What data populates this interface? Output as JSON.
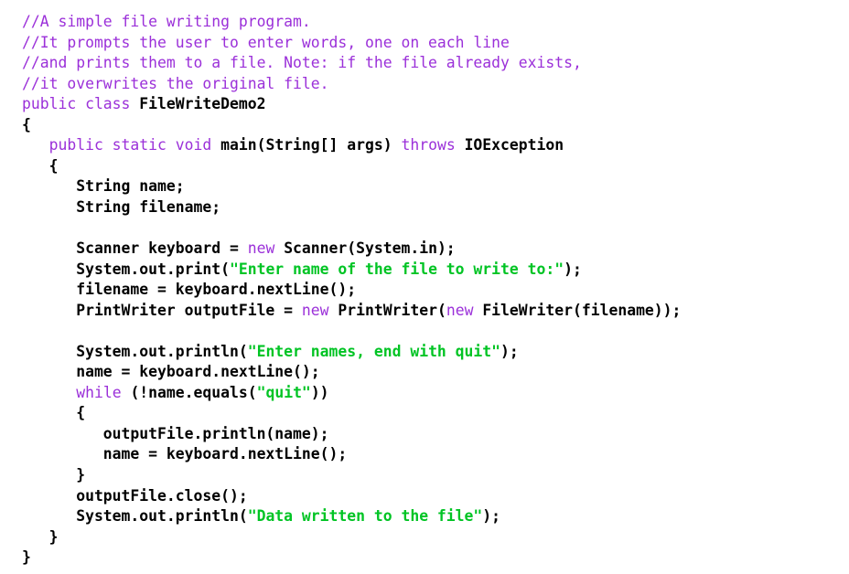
{
  "document": {
    "kind": "source-code-listing",
    "language": "Java",
    "class_name": "FileWriteDemo2",
    "background_color": "#ffffff",
    "colors": {
      "comment": "#9B30D9",
      "keyword": "#9B30D9",
      "string": "#00C424",
      "plain": "#000000"
    }
  },
  "code": {
    "lines": [
      {
        "n": 1,
        "text": "//A simple file writing program.",
        "tokens": [
          {
            "t": "comment",
            "v": "//A simple file writing program."
          }
        ]
      },
      {
        "n": 2,
        "text": "//It prompts the user to enter words, one on each line",
        "tokens": [
          {
            "t": "comment",
            "v": "//It prompts the user to enter words, one on each line"
          }
        ]
      },
      {
        "n": 3,
        "text": "//and prints them to a file. Note: if the file already exists,",
        "tokens": [
          {
            "t": "comment",
            "v": "//and prints them to a file. Note: if the file already exists,"
          }
        ]
      },
      {
        "n": 4,
        "text": "//it overwrites the original file.",
        "tokens": [
          {
            "t": "comment",
            "v": "//it overwrites the original file."
          }
        ]
      },
      {
        "n": 5,
        "text": "public class FileWriteDemo2",
        "tokens": [
          {
            "t": "keyword",
            "v": "public class "
          },
          {
            "t": "plain",
            "v": "FileWriteDemo2"
          }
        ]
      },
      {
        "n": 6,
        "text": "{",
        "tokens": [
          {
            "t": "plain",
            "v": "{"
          }
        ]
      },
      {
        "n": 7,
        "text": "   public static void main(String[] args) throws IOException",
        "tokens": [
          {
            "t": "plain",
            "v": "   "
          },
          {
            "t": "keyword",
            "v": "public static void "
          },
          {
            "t": "plain",
            "v": "main(String[] args) "
          },
          {
            "t": "keyword",
            "v": "throws "
          },
          {
            "t": "plain",
            "v": "IOException"
          }
        ]
      },
      {
        "n": 8,
        "text": "   {",
        "tokens": [
          {
            "t": "plain",
            "v": "   {"
          }
        ]
      },
      {
        "n": 9,
        "text": "      String name;",
        "tokens": [
          {
            "t": "plain",
            "v": "      String name;"
          }
        ]
      },
      {
        "n": 10,
        "text": "      String filename;",
        "tokens": [
          {
            "t": "plain",
            "v": "      String filename;"
          }
        ]
      },
      {
        "n": 11,
        "text": "",
        "tokens": []
      },
      {
        "n": 12,
        "text": "      Scanner keyboard = new Scanner(System.in);",
        "tokens": [
          {
            "t": "plain",
            "v": "      Scanner keyboard = "
          },
          {
            "t": "keyword",
            "v": "new "
          },
          {
            "t": "plain",
            "v": "Scanner(System.in);"
          }
        ]
      },
      {
        "n": 13,
        "text": "      System.out.print(\"Enter name of the file to write to:\");",
        "tokens": [
          {
            "t": "plain",
            "v": "      System.out.print("
          },
          {
            "t": "string",
            "v": "\"Enter name of the file to write to:\""
          },
          {
            "t": "plain",
            "v": ");"
          }
        ]
      },
      {
        "n": 14,
        "text": "      filename = keyboard.nextLine();",
        "tokens": [
          {
            "t": "plain",
            "v": "      filename = keyboard.nextLine();"
          }
        ]
      },
      {
        "n": 15,
        "text": "      PrintWriter outputFile = new PrintWriter(new FileWriter(filename));",
        "tokens": [
          {
            "t": "plain",
            "v": "      PrintWriter outputFile = "
          },
          {
            "t": "keyword",
            "v": "new "
          },
          {
            "t": "plain",
            "v": "PrintWriter("
          },
          {
            "t": "keyword",
            "v": "new "
          },
          {
            "t": "plain",
            "v": "FileWriter(filename));"
          }
        ]
      },
      {
        "n": 16,
        "text": "",
        "tokens": []
      },
      {
        "n": 17,
        "text": "      System.out.println(\"Enter names, end with quit\");",
        "tokens": [
          {
            "t": "plain",
            "v": "      System.out.println("
          },
          {
            "t": "string",
            "v": "\"Enter names, end with quit\""
          },
          {
            "t": "plain",
            "v": ");"
          }
        ]
      },
      {
        "n": 18,
        "text": "      name = keyboard.nextLine();",
        "tokens": [
          {
            "t": "plain",
            "v": "      name = keyboard.nextLine();"
          }
        ]
      },
      {
        "n": 19,
        "text": "      while (!name.equals(\"quit\"))",
        "tokens": [
          {
            "t": "plain",
            "v": "      "
          },
          {
            "t": "keyword",
            "v": "while "
          },
          {
            "t": "plain",
            "v": "(!name.equals("
          },
          {
            "t": "string",
            "v": "\"quit\""
          },
          {
            "t": "plain",
            "v": "))"
          }
        ]
      },
      {
        "n": 20,
        "text": "      {",
        "tokens": [
          {
            "t": "plain",
            "v": "      {"
          }
        ]
      },
      {
        "n": 21,
        "text": "         outputFile.println(name);",
        "tokens": [
          {
            "t": "plain",
            "v": "         outputFile.println(name);"
          }
        ]
      },
      {
        "n": 22,
        "text": "         name = keyboard.nextLine();",
        "tokens": [
          {
            "t": "plain",
            "v": "         name = keyboard.nextLine();"
          }
        ]
      },
      {
        "n": 23,
        "text": "      }",
        "tokens": [
          {
            "t": "plain",
            "v": "      }"
          }
        ]
      },
      {
        "n": 24,
        "text": "      outputFile.close();",
        "tokens": [
          {
            "t": "plain",
            "v": "      outputFile.close();"
          }
        ]
      },
      {
        "n": 25,
        "text": "      System.out.println(\"Data written to the file\");",
        "tokens": [
          {
            "t": "plain",
            "v": "      System.out.println("
          },
          {
            "t": "string",
            "v": "\"Data written to the file\""
          },
          {
            "t": "plain",
            "v": ");"
          }
        ]
      },
      {
        "n": 26,
        "text": "   }",
        "tokens": [
          {
            "t": "plain",
            "v": "   }"
          }
        ]
      },
      {
        "n": 27,
        "text": "}",
        "tokens": [
          {
            "t": "plain",
            "v": "}"
          }
        ]
      }
    ]
  }
}
